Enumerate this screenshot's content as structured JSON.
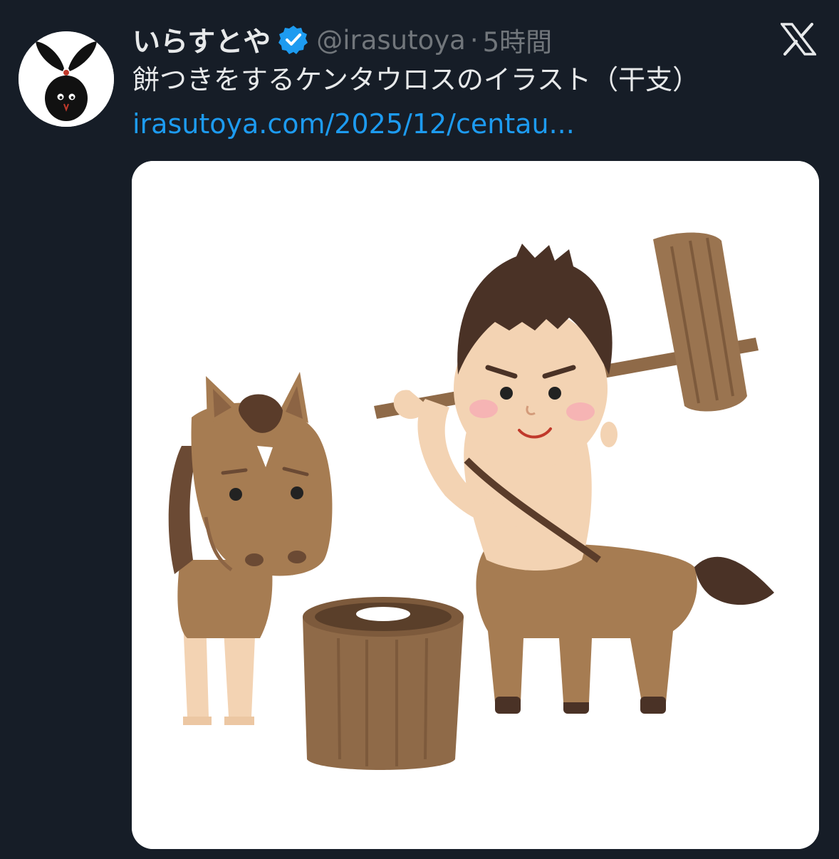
{
  "post": {
    "author": {
      "display_name": "いらすとや",
      "handle": "@irasutoya",
      "verified": true,
      "avatar_icon": "rabbit-silhouette-icon"
    },
    "separator": "·",
    "timestamp": "5時間",
    "text": "餅つきをするケンタウロスのイラスト（干支）",
    "link": "irasutoya.com/2025/12/centau...",
    "platform_icon": "x-logo-icon",
    "media": {
      "alt": "",
      "illustration": "centaur-pounding-mochi"
    }
  },
  "colors": {
    "background": "#161d27",
    "text_primary": "#e7e9ea",
    "text_secondary": "#71767b",
    "link": "#1d9bf0",
    "verified_badge": "#1d9bf0"
  }
}
